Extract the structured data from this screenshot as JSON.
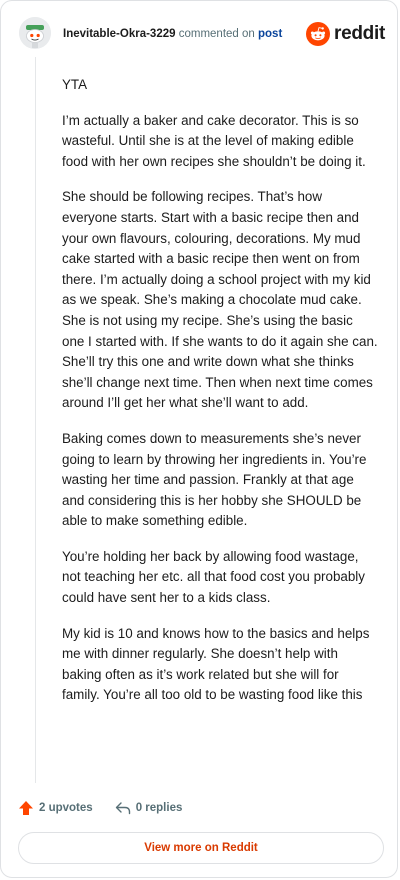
{
  "header": {
    "username": "Inevitable-Okra-3229",
    "commented_text": "commented on",
    "post_link": "post",
    "brand": "reddit"
  },
  "comment": {
    "paragraphs": [
      "YTA",
      "I’m actually a baker and cake decorator. This is so wasteful. Until she is at the level of making edible food with her own recipes she shouldn’t be doing it.",
      "She should be following recipes. That’s how everyone starts. Start with a basic recipe then and your own flavours, colouring, decorations. My mud cake started with a basic recipe then went on from there. I’m actually doing a school project with my kid as we speak. She’s making a chocolate mud cake. She is not using my recipe. She’s using the basic one I started with. If she wants to do it again she can. She’ll try this one and write down what she thinks she’ll change next time. Then when next time comes around I’ll get her what she’ll want to add.",
      "Baking comes down to measurements she’s never going to learn by throwing her ingredients in. You’re wasting her time and passion. Frankly at that age and considering this is her hobby she SHOULD be able to make something edible.",
      "You’re holding her back by allowing food wastage, not teaching her etc. all that food cost you probably could have sent her to a kids class.",
      "My kid is 10 and knows how to the basics and helps me with dinner regularly. She doesn’t help with baking often as it’s work related but she will for family. You’re all too old to be wasting food like this"
    ]
  },
  "actions": {
    "upvotes": "2 upvotes",
    "replies": "0 replies"
  },
  "footer": {
    "view_more": "View more on Reddit"
  },
  "colors": {
    "upvote": "#ff4500",
    "brand": "#ff4500",
    "link": "#0a449b",
    "view_more": "#d93a00"
  }
}
